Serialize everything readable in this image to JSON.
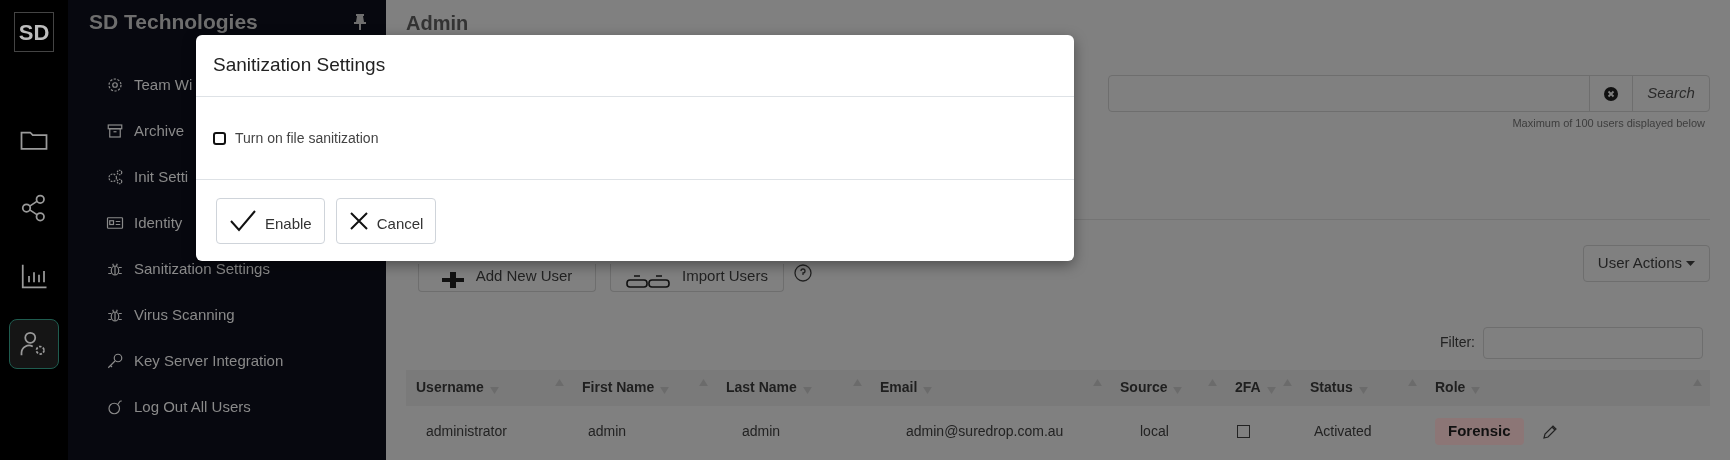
{
  "rail": {
    "logo": "SD",
    "items": [
      {
        "selected": false
      },
      {
        "selected": false
      },
      {
        "selected": false
      },
      {
        "selected": true
      }
    ]
  },
  "sidebar": {
    "title": "SD Technologies",
    "items": [
      {
        "label": "Team Wi"
      },
      {
        "label": "Archive"
      },
      {
        "label": "Init Setti"
      },
      {
        "label": "Identity"
      },
      {
        "label": "Sanitization Settings"
      },
      {
        "label": "Virus Scanning"
      },
      {
        "label": "Key Server Integration"
      },
      {
        "label": "Log Out All Users"
      }
    ]
  },
  "main": {
    "title": "Admin",
    "search_button": "Search",
    "hint": "Maximum of 100 users displayed below",
    "add_button": "Add New User",
    "import_button": "Import Users",
    "user_actions": "User Actions",
    "filter_label": "Filter:",
    "table": {
      "columns": [
        "Username",
        "First Name",
        "Last Name",
        "Email",
        "Source",
        "2FA",
        "Status",
        "Role"
      ],
      "rows": [
        {
          "username": "administrator",
          "first_name": "admin",
          "last_name": "admin",
          "email": "admin@suredrop.com.au",
          "source": "local",
          "two_fa": false,
          "status": "Activated",
          "role": "Forensic"
        }
      ]
    }
  },
  "modal": {
    "title": "Sanitization Settings",
    "checkbox": {
      "label": "Turn on file sanitization",
      "checked": false
    },
    "buttons": [
      {
        "kind": "confirm",
        "label": "Enable"
      },
      {
        "kind": "cancel",
        "label": "Cancel"
      }
    ]
  }
}
